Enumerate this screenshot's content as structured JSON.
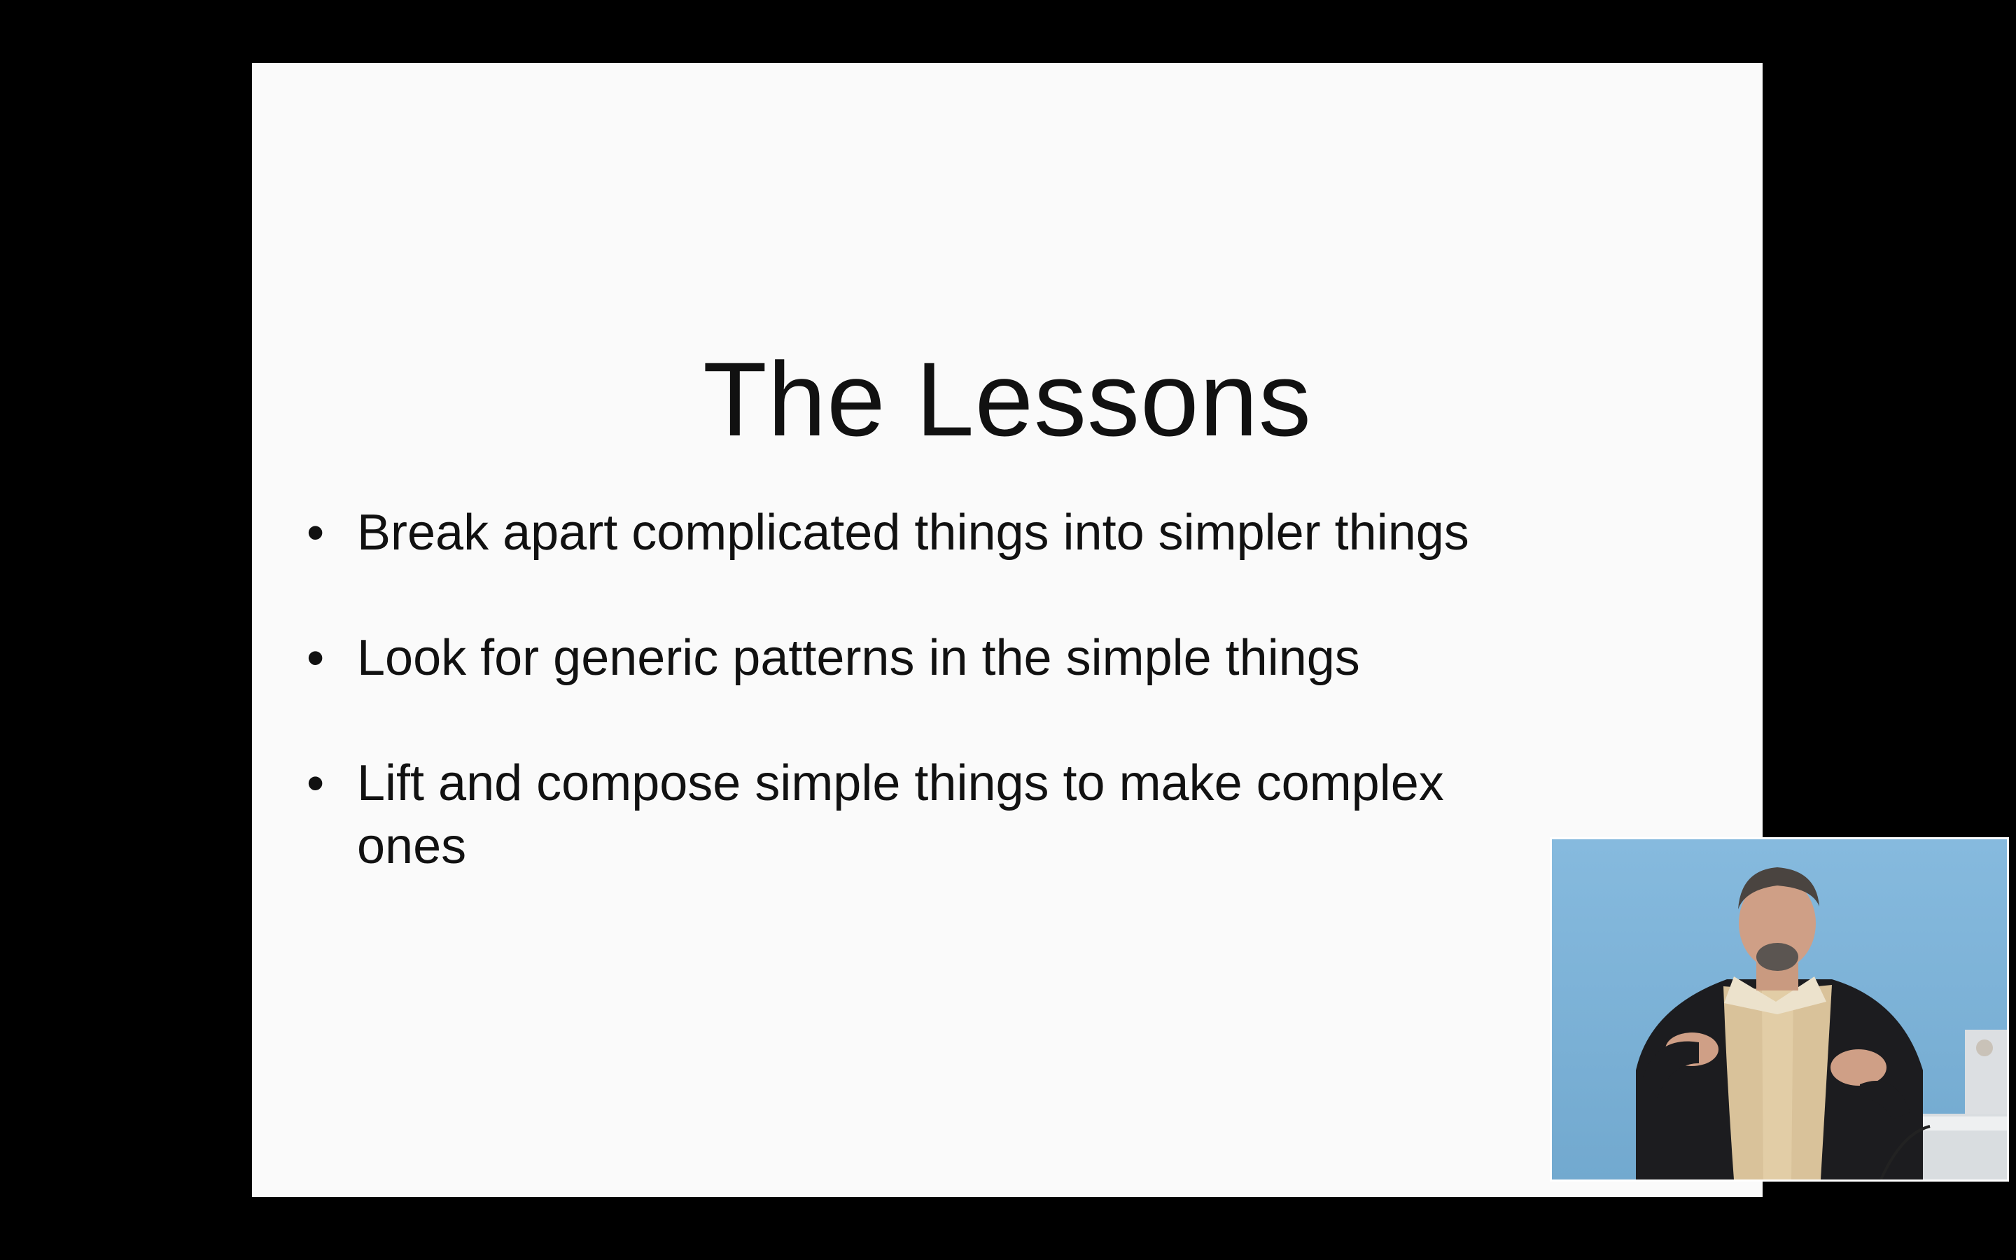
{
  "slide": {
    "title": "The Lessons",
    "bullets": [
      "Break apart complicated things into simpler things",
      "Look for generic patterns in the simple things",
      "Lift and compose simple things to make complex ones"
    ]
  },
  "presenter_video": {
    "background_color": "#7fb5d8"
  }
}
